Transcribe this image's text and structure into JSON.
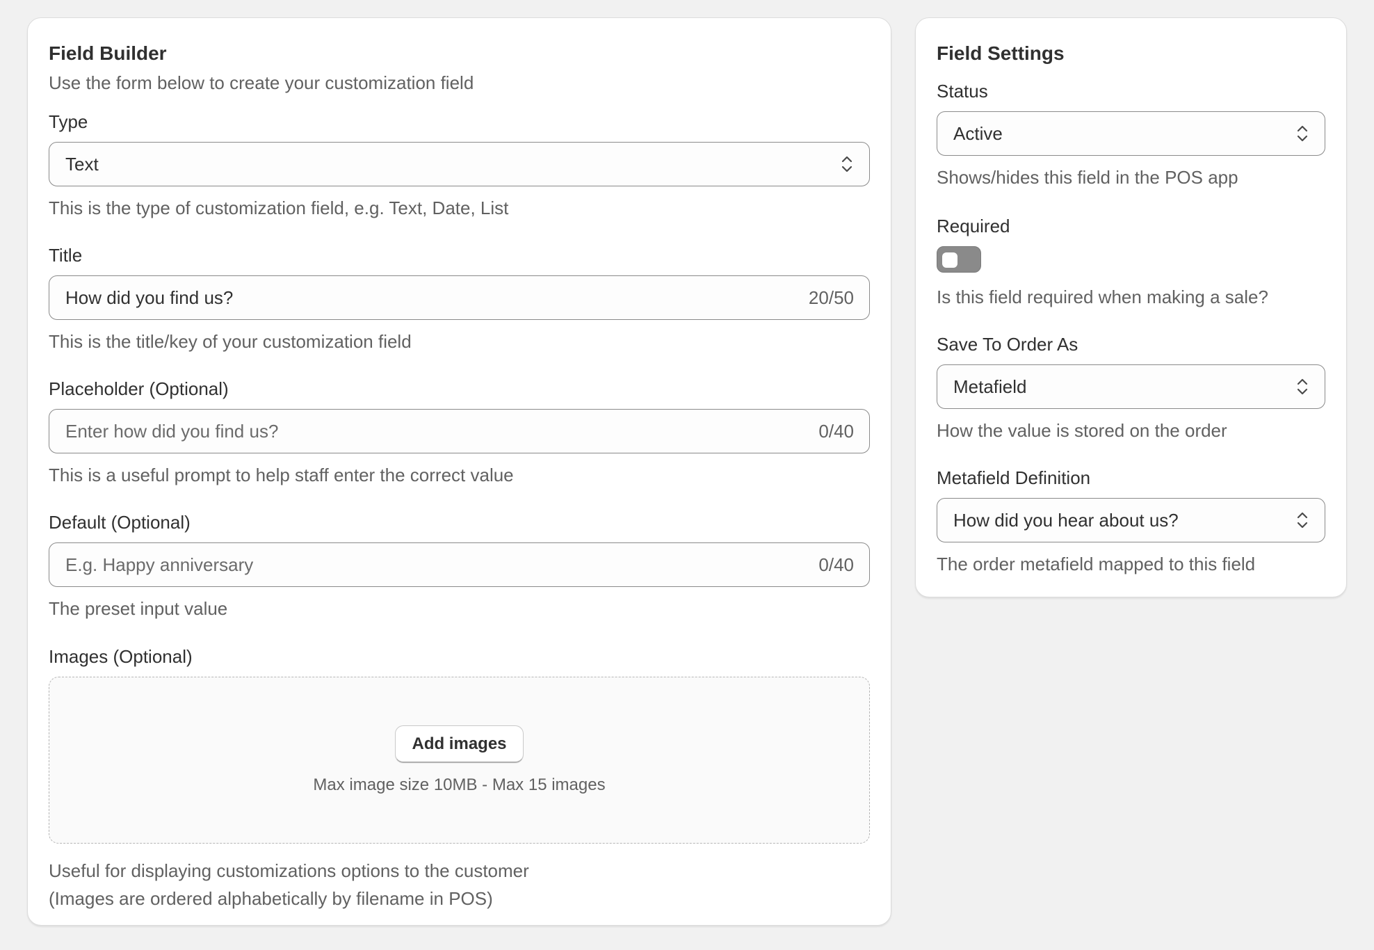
{
  "builder": {
    "title": "Field Builder",
    "subtitle": "Use the form below to create your customization field",
    "type": {
      "label": "Type",
      "value": "Text",
      "help": "This is the type of customization field, e.g. Text, Date, List"
    },
    "title_field": {
      "label": "Title",
      "value": "How did you find us?",
      "counter": "20/50",
      "help": "This is the title/key of your customization field"
    },
    "placeholder_field": {
      "label": "Placeholder (Optional)",
      "placeholder": "Enter how did you find us?",
      "counter": "0/40",
      "help": "This is a useful prompt to help staff enter the correct value"
    },
    "default_field": {
      "label": "Default (Optional)",
      "placeholder": "E.g. Happy anniversary",
      "counter": "0/40",
      "help": "The preset input value"
    },
    "images": {
      "label": "Images (Optional)",
      "button": "Add images",
      "hint": "Max image size 10MB - Max 15 images",
      "help_line1": "Useful for displaying customizations options to the customer",
      "help_line2": "(Images are ordered alphabetically by filename in POS)"
    }
  },
  "settings": {
    "title": "Field Settings",
    "status": {
      "label": "Status",
      "value": "Active",
      "help": "Shows/hides this field in the POS app"
    },
    "required": {
      "label": "Required",
      "on": false,
      "help": "Is this field required when making a sale?"
    },
    "save_to_order": {
      "label": "Save To Order As",
      "value": "Metafield",
      "help": "How the value is stored on the order"
    },
    "metafield_definition": {
      "label": "Metafield Definition",
      "value": "How did you hear about us?",
      "help": "The order metafield mapped to this field"
    }
  },
  "icons": {
    "select_chevron": "chevron-up-down-icon"
  },
  "colors": {
    "background": "#f1f1f1",
    "card": "#ffffff",
    "text": "#303030",
    "muted_text": "#616161",
    "border": "#8a8a8a",
    "toggle_off": "#8a8a8a"
  }
}
